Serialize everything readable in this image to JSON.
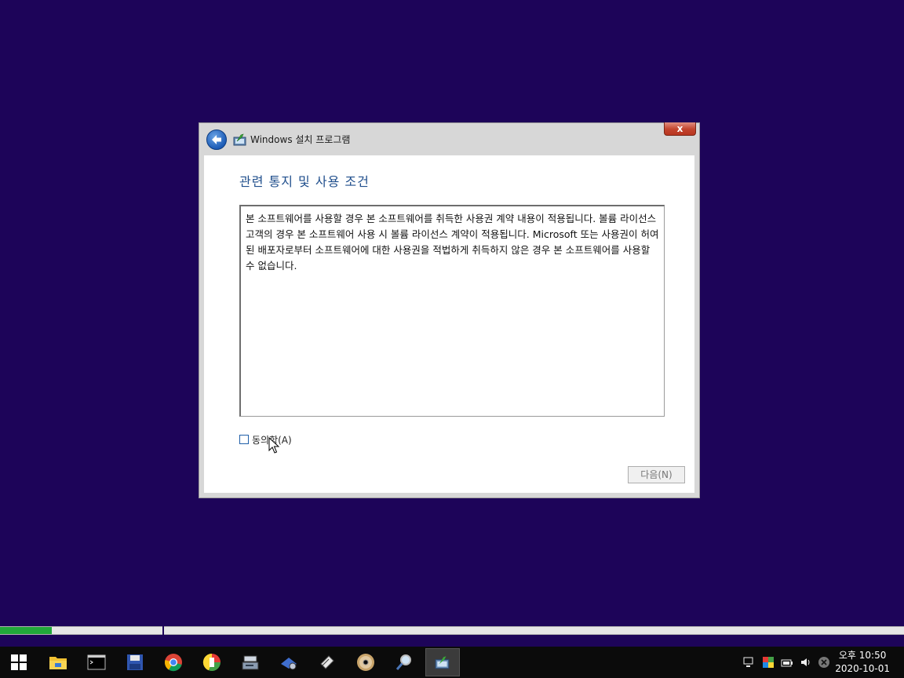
{
  "window": {
    "title": "Windows 설치 프로그램",
    "close_label": "x"
  },
  "page": {
    "heading": "관련 통지 및 사용 조건",
    "license_text": "본 소프트웨어를 사용할 경우 본 소프트웨어를 취득한 사용권 계약 내용이 적용됩니다. 볼륨 라이선스 고객의 경우 본 소프트웨어 사용 시 볼륨 라이선스 계약이 적용됩니다. Microsoft 또는 사용권이 허여된 배포자로부터 소프트웨어에 대한 사용권을 적법하게 취득하지 않은 경우 본 소프트웨어를 사용할 수 없습니다.",
    "agree_label": "동의함(A)",
    "agree_checked": false,
    "next_label": "다음(N)",
    "next_enabled": false
  },
  "progress": {
    "fraction": 0.057
  },
  "taskbar": {
    "items": [
      {
        "icon": "start-windows-icon"
      },
      {
        "icon": "file-explorer-icon"
      },
      {
        "icon": "command-prompt-icon"
      },
      {
        "icon": "floppy-save-icon"
      },
      {
        "icon": "chrome-icon"
      },
      {
        "icon": "partition-tool-icon"
      },
      {
        "icon": "disk-tool-icon"
      },
      {
        "icon": "network-tool-icon"
      },
      {
        "icon": "usb-drive-icon"
      },
      {
        "icon": "cd-disc-icon"
      },
      {
        "icon": "search-magnifier-icon"
      },
      {
        "icon": "windows-setup-icon"
      }
    ],
    "tray_icons": [
      "network-icon",
      "color-icon",
      "battery-icon",
      "volume-icon",
      "close-circle-icon"
    ],
    "clock_time": "오후 10:50",
    "clock_date": "2020-10-01"
  },
  "colors": {
    "desktop_bg": "#1d0459",
    "heading": "#1f4e8c",
    "progress_fill": "#21a83a",
    "close_button": "#c2432d"
  }
}
